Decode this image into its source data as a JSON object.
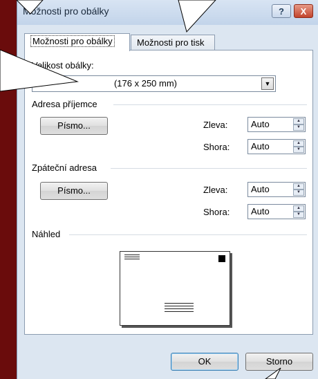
{
  "window": {
    "title": "Možnosti pro obálky",
    "help_glyph": "?",
    "close_glyph": "X"
  },
  "tabs": [
    {
      "label": "Možnosti pro obálky",
      "selected": true
    },
    {
      "label": "Možnosti pro tisk",
      "selected": false
    }
  ],
  "envelope_size": {
    "label": "Velikost obálky:",
    "value": "(176 x 250 mm)"
  },
  "recipient": {
    "section_title": "Adresa příjemce",
    "font_button": "Písmo...",
    "left_label": "Zleva:",
    "left_value": "Auto",
    "top_label": "Shora:",
    "top_value": "Auto"
  },
  "return_address": {
    "section_title": "Zpáteční adresa",
    "font_button": "Písmo...",
    "left_label": "Zleva:",
    "left_value": "Auto",
    "top_label": "Shora:",
    "top_value": "Auto"
  },
  "preview": {
    "section_title": "Náhled"
  },
  "footer": {
    "ok_label": "OK",
    "cancel_label": "Storno"
  },
  "colors": {
    "background": "#6a0c0c",
    "dialog": "#dce6f1",
    "close_button": "#c2442c"
  }
}
